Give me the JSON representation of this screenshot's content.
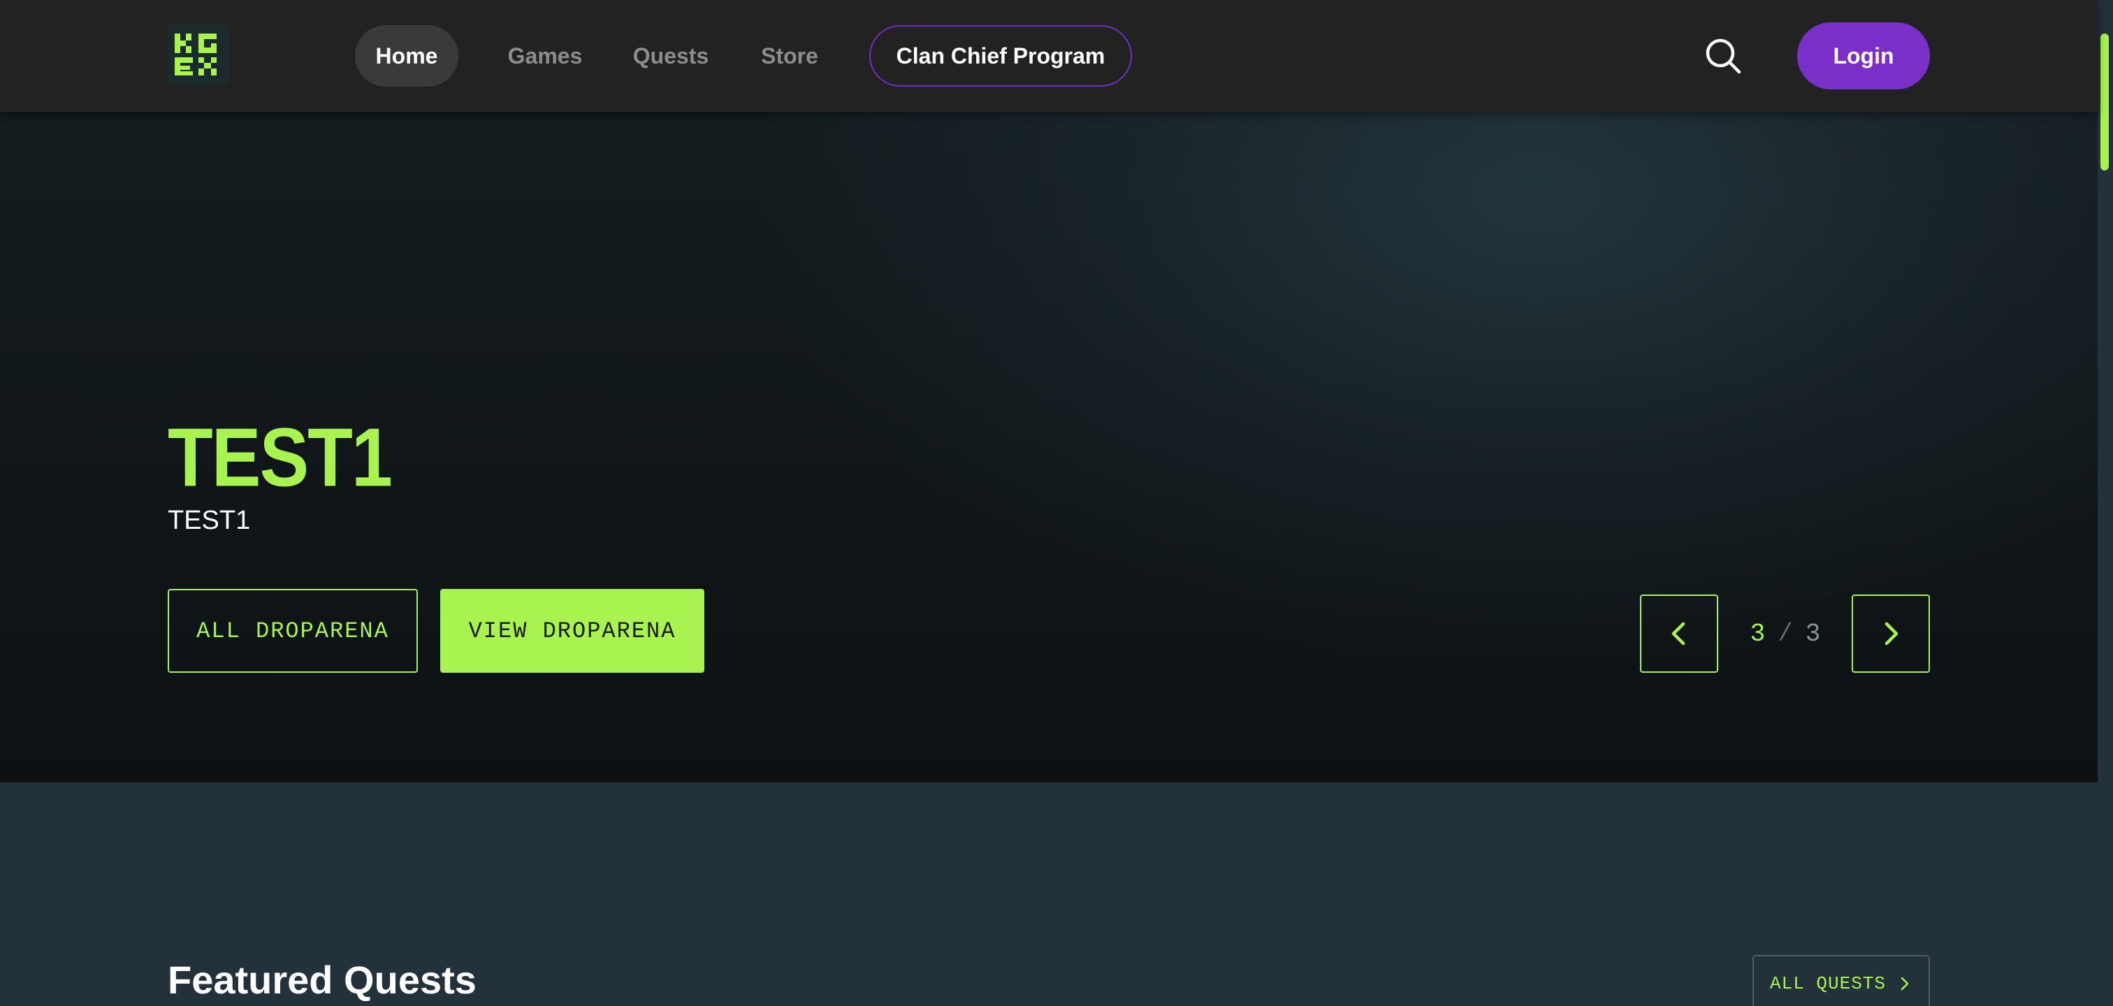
{
  "colors": {
    "accent": "#a8f34f",
    "brand_purple": "#7b2fc9",
    "nav_bg": "#222222",
    "page_bg": "#22313a"
  },
  "header": {
    "logo_icon": "kgen-logo-icon",
    "nav": {
      "home": "Home",
      "games": "Games",
      "quests": "Quests",
      "store": "Store",
      "clan_chief": "Clan Chief Program"
    },
    "search_icon": "search-icon",
    "login_label": "Login"
  },
  "hero": {
    "title": "TEST1",
    "subtitle": "TEST1",
    "primary_button": "ALL DROPARENA",
    "secondary_button": "VIEW DROPARENA",
    "pager": {
      "current": "3",
      "separator": "/",
      "total": "3",
      "prev_icon": "chevron-left-icon",
      "next_icon": "chevron-right-icon"
    }
  },
  "featured": {
    "title": "Featured Quests",
    "all_button": "ALL QUESTS",
    "all_button_icon": "chevron-right-icon"
  }
}
